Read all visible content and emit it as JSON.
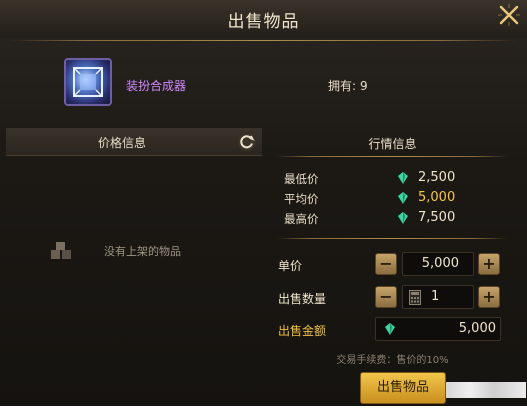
{
  "window": {
    "title": "出售物品"
  },
  "item": {
    "name": "装扮合成器",
    "owned_label": "拥有:",
    "owned_count": "9"
  },
  "price_panel": {
    "header": "价格信息",
    "empty_text": "没有上架的物品"
  },
  "market": {
    "header": "行情信息",
    "stats": [
      {
        "label": "最低价",
        "value": "2,500"
      },
      {
        "label": "平均价",
        "value": "5,000"
      },
      {
        "label": "最高价",
        "value": "7,500"
      }
    ]
  },
  "form": {
    "unit_price_label": "单价",
    "unit_price_value": "5,000",
    "qty_label": "出售数量",
    "qty_value": "1",
    "total_label": "出售金额",
    "total_value": "5,000",
    "fee_note": "交易手续费：售价的10%",
    "minus": "−",
    "plus": "+"
  },
  "actions": {
    "sell_label": "出售物品"
  },
  "colors": {
    "accent_gold": "#f0c040",
    "item_purple": "#d189ff",
    "gem": "#3fd2a0"
  },
  "icons": [
    "close-icon",
    "refresh-icon",
    "gem-icon",
    "calculator-icon",
    "empty-box-icon",
    "item-icon"
  ]
}
